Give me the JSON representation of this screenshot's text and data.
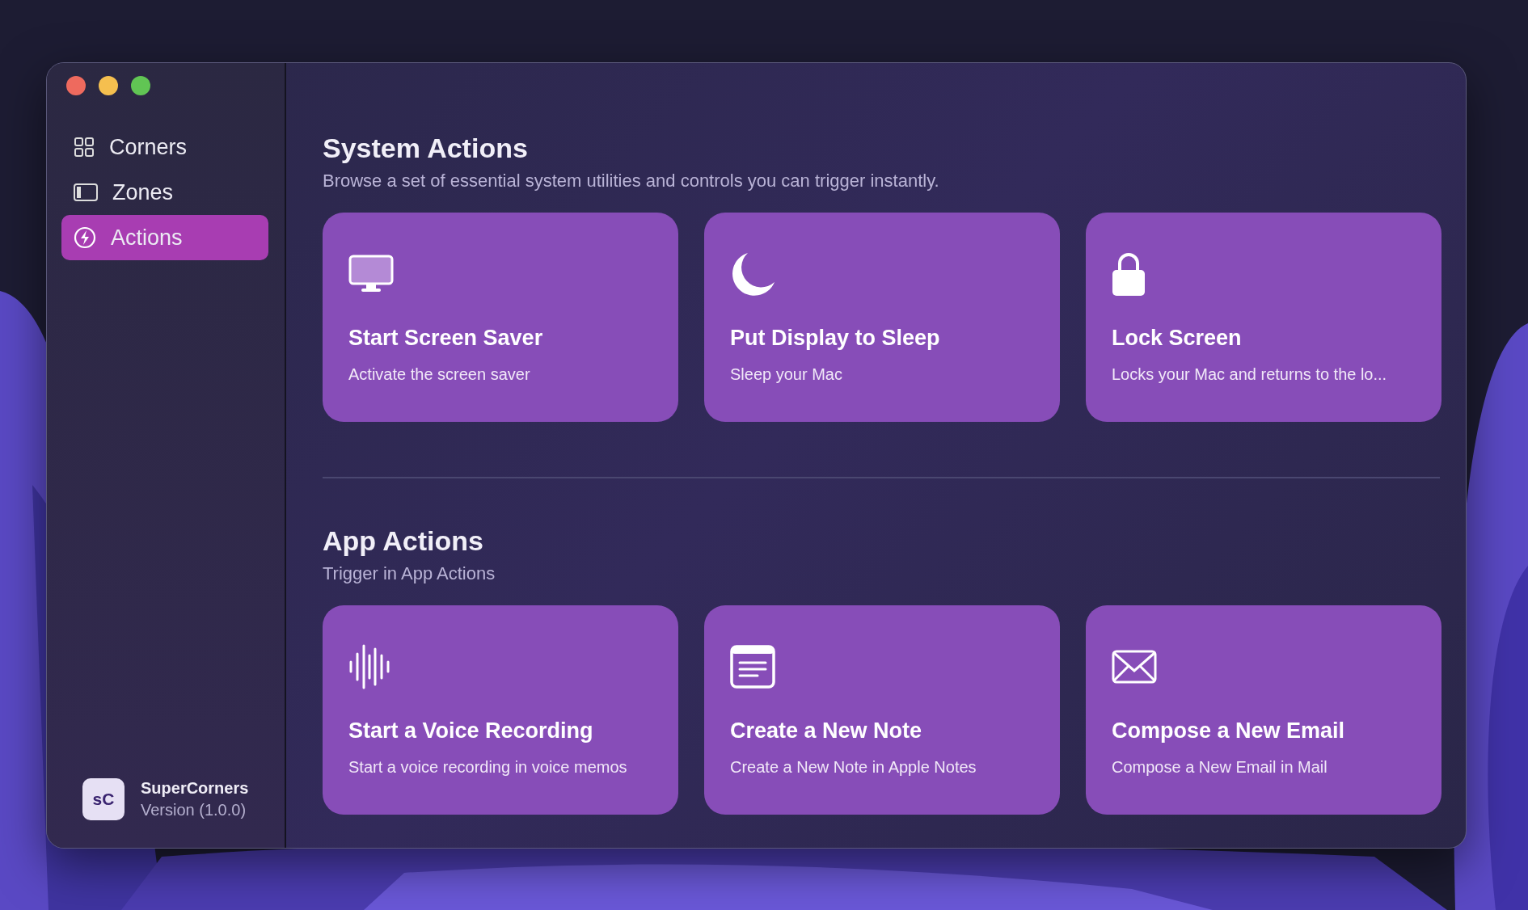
{
  "sidebar": {
    "items": [
      {
        "label": "Corners",
        "selected": false
      },
      {
        "label": "Zones",
        "selected": false
      },
      {
        "label": "Actions",
        "selected": true
      }
    ],
    "app": {
      "badge": "sC",
      "name": "SuperCorners",
      "version": "Version (1.0.0)"
    }
  },
  "sections": [
    {
      "title": "System Actions",
      "subtitle": "Browse a set of essential system utilities and controls you can trigger instantly.",
      "cards": [
        {
          "title": "Start Screen Saver",
          "description": "Activate the screen saver"
        },
        {
          "title": "Put Display to Sleep",
          "description": "Sleep your Mac"
        },
        {
          "title": "Lock Screen",
          "description": "Locks your Mac and returns to the lo..."
        }
      ]
    },
    {
      "title": "App Actions",
      "subtitle": "Trigger in App Actions",
      "cards": [
        {
          "title": "Start a Voice Recording",
          "description": "Start a voice recording in voice memos"
        },
        {
          "title": "Create a New Note",
          "description": "Create a New Note in Apple Notes"
        },
        {
          "title": "Compose a New Email",
          "description": "Compose a New Email in Mail"
        }
      ]
    }
  ]
}
